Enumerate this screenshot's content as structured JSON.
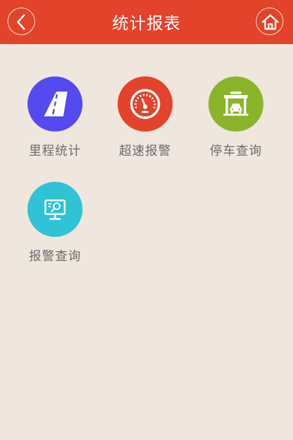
{
  "header": {
    "title": "统计报表",
    "back_icon": "chevron-left-icon",
    "home_icon": "home-icon",
    "background_color": "#e2432a"
  },
  "menu": {
    "items": [
      {
        "id": "mileage",
        "label": "里程统计",
        "icon": "road-icon",
        "color": "#544af0"
      },
      {
        "id": "speeding",
        "label": "超速报警",
        "icon": "speedometer-icon",
        "color": "#e2432a"
      },
      {
        "id": "parking",
        "label": "停车查询",
        "icon": "garage-car-icon",
        "color": "#8ab52b"
      },
      {
        "id": "alarm",
        "label": "报警查询",
        "icon": "monitor-search-icon",
        "color": "#2fc3d6"
      }
    ]
  },
  "page": {
    "background_color": "#efe6de"
  }
}
